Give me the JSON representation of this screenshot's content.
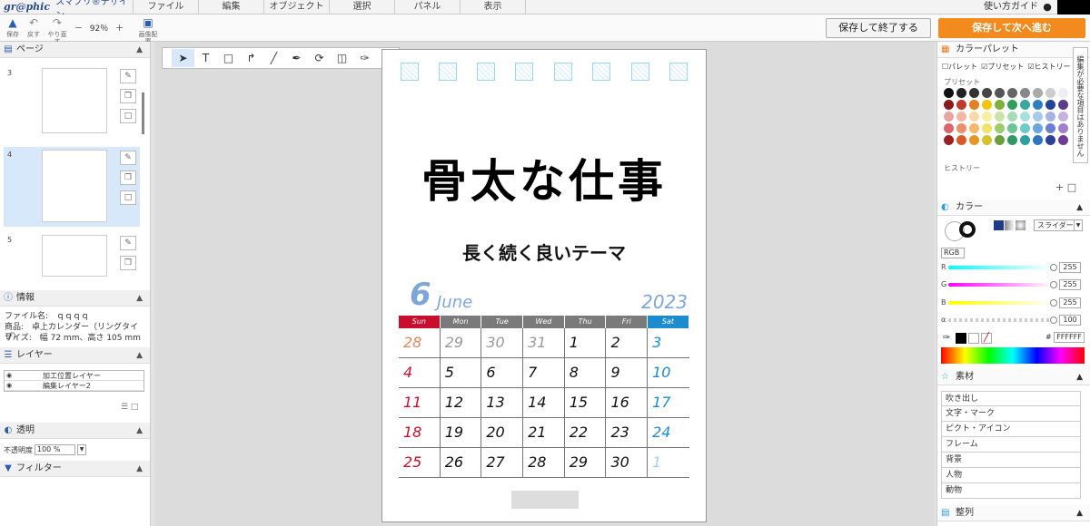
{
  "brand": {
    "logo": "gr@phic",
    "app": "スマプリ®デザイン"
  },
  "menu": [
    "ファイル",
    "編集",
    "オブジェクト",
    "選択",
    "パネル",
    "表示"
  ],
  "guide": "使い方ガイド",
  "toolbar": {
    "save": "保存",
    "undo": "戻す",
    "redo": "やり直す",
    "zoom": "92％",
    "imgplace": "画像配置"
  },
  "buttons": {
    "save_exit": "保存して終了する",
    "save_next": "保存して次へ進む"
  },
  "left": {
    "pages_title": "ページ",
    "pages": [
      "3",
      "4",
      "5"
    ],
    "info_title": "情報",
    "file_name": "ファイル名:　ｑｑｑｑ",
    "product": "商品:　卓上カレンダー（リングタイプ）",
    "size": "サイズ:　幅 72 mm、高さ 105 mm",
    "layers_title": "レイヤー",
    "layers": [
      "加工位置レイヤー",
      "編集レイヤー2"
    ],
    "transparency_title": "透明",
    "opacity_label": "不透明度",
    "opacity_value": "100 %",
    "filter_title": "フィルター"
  },
  "page": {
    "title": "骨太な仕事",
    "subtitle": "長く続く良いテーマ",
    "month_num": "6",
    "month_name": "June",
    "year": "2023",
    "dow": [
      "Sun",
      "Mon",
      "Tue",
      "Wed",
      "Thu",
      "Fri",
      "Sat"
    ],
    "dow_colors": [
      "#c8102e",
      "#7a7a7a",
      "#7a7a7a",
      "#7a7a7a",
      "#7a7a7a",
      "#7a7a7a",
      "#1c8ccf"
    ],
    "weeks": [
      [
        "28",
        "29",
        "30",
        "31",
        "1",
        "2",
        "3"
      ],
      [
        "4",
        "5",
        "6",
        "7",
        "8",
        "9",
        "10"
      ],
      [
        "11",
        "12",
        "13",
        "14",
        "15",
        "16",
        "17"
      ],
      [
        "18",
        "19",
        "20",
        "21",
        "22",
        "23",
        "24"
      ],
      [
        "25",
        "26",
        "27",
        "28",
        "29",
        "30",
        "1"
      ]
    ]
  },
  "right": {
    "palette_title": "カラーパレット",
    "tabs": [
      "パレット",
      "プリセット",
      "ヒストリー"
    ],
    "preset_label": "プリセット",
    "history_label": "ヒストリー",
    "color_title": "カラー",
    "mode": "スライダー",
    "model": "RGB",
    "r_label": "R",
    "g_label": "G",
    "b_label": "B",
    "a_label": "α",
    "r": "255",
    "g": "255",
    "b": "255",
    "a": "100",
    "hex_label": "#",
    "hex": "FFFFFF",
    "materials_title": "素材",
    "materials": [
      "吹き出し",
      "文字・マーク",
      "ピクト・アイコン",
      "フレーム",
      "背景",
      "人物",
      "動物"
    ],
    "align_title": "整列",
    "side_note": "編集が必要な項目はありません"
  },
  "swatches": [
    "#111",
    "#222",
    "#333",
    "#444",
    "#555",
    "#666",
    "#888",
    "#aaa",
    "#ccc",
    "#eee",
    "#8b1a1a",
    "#c0392b",
    "#e67e22",
    "#f1c40f",
    "#7fb03f",
    "#2e9f5b",
    "#3aa7a0",
    "#2d7fc1",
    "#23439a",
    "#5b3b8c",
    "#e8a3a3",
    "#f3b6a3",
    "#f7d8a8",
    "#f7ef9f",
    "#cde3a6",
    "#a8dcb9",
    "#a9dede",
    "#a7c9ec",
    "#a9b3df",
    "#c6b2dd",
    "#d9666a",
    "#ee8f6b",
    "#f5b86a",
    "#f2e26a",
    "#9ccc6b",
    "#6cc593",
    "#6ccbcb",
    "#6aa6df",
    "#6c7fcf",
    "#a07fcf",
    "#9c1f24",
    "#d85a2b",
    "#e59624",
    "#d6c22c",
    "#67a03c",
    "#339764",
    "#2e9ea0",
    "#2f74bc",
    "#2c3f9a",
    "#6c3c96"
  ]
}
